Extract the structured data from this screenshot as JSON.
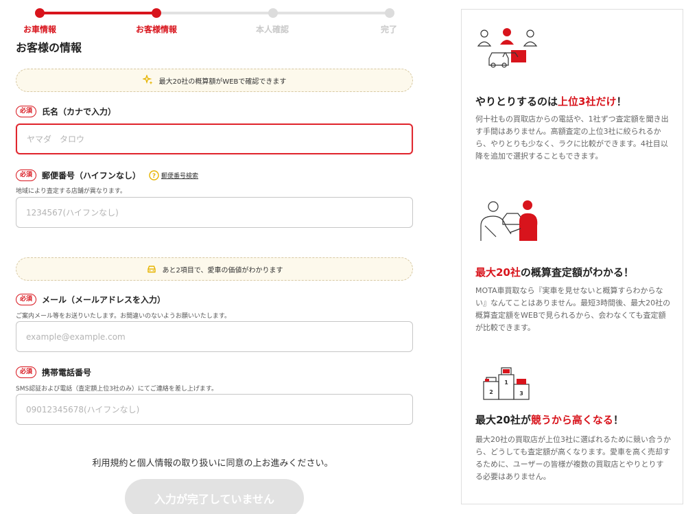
{
  "steps": [
    {
      "label": "お車情報",
      "state": "done"
    },
    {
      "label": "お客様情報",
      "state": "current"
    },
    {
      "label": "本人確認",
      "state": "pending"
    },
    {
      "label": "完了",
      "state": "pending"
    }
  ],
  "form": {
    "section_title": "お客様の情報",
    "notice_top": "最大20社の概算額がWEBで確認できます",
    "notice_mid": "あと2項目で、愛車の価値がわかります",
    "required_badge": "必須",
    "name": {
      "label": "氏名（カナで入力）",
      "placeholder": "ヤマダ　タロウ",
      "value": ""
    },
    "postal": {
      "label": "郵便番号（ハイフンなし）",
      "help_link": "郵便番号検索",
      "note": "地域により査定する店舗が異なります。",
      "placeholder": "1234567(ハイフンなし)",
      "value": ""
    },
    "email": {
      "label": "メール（メールアドレスを入力）",
      "note": "ご案内メール等をお送りいたします。お間違いのないようお願いいたします。",
      "placeholder": "example@example.com",
      "value": ""
    },
    "phone": {
      "label": "携帯電話番号",
      "note": "SMS認証および電話（査定額上位3社のみ）にてご連絡を差し上げます。",
      "placeholder": "09012345678(ハイフンなし)",
      "value": ""
    },
    "agree_text": "利用規約と個人情報の取り扱いに同意の上お進みください。",
    "submit_label": "入力が完了していません"
  },
  "side": {
    "features": [
      {
        "head_pre": "やりとりするのは",
        "head_hl": "上位3社だけ",
        "head_post": "！",
        "body": "何十社もの買取店からの電話や、1社ずつ査定額を聞き出す手間はありません。高額査定の上位3社に絞られるから、やりとりも少なく、ラクに比較ができます。4社目以降を追加で選択することもできます。",
        "icon": "dealers-people-icon"
      },
      {
        "head_pre": "",
        "head_hl": "最大20社",
        "head_post": "の概算査定額がわかる！",
        "body": "MOTA車買取なら『実車を見せないと概算すらわからない』なんてことはありません。最短3時間後、最大20社の概算査定額をWEBで見られるから、会わなくても査定額が比較できます。",
        "icon": "handover-icon"
      },
      {
        "head_pre": "最大20社が",
        "head_hl": "競うから高くなる",
        "head_post": "！",
        "body": "最大20社の買取店が上位3社に選ばれるために競い合うから、どうしても査定額が高くなります。愛車を高く売却するために、ユーザーの皆様が複数の買取店とやりとりする必要はありません。",
        "icon": "podium-icon",
        "podium": [
          "1",
          "2",
          "3"
        ]
      }
    ]
  },
  "colors": {
    "accent": "#d8141c",
    "notice_bg": "#fdf9ec",
    "disabled_btn": "#e2e2e2"
  }
}
